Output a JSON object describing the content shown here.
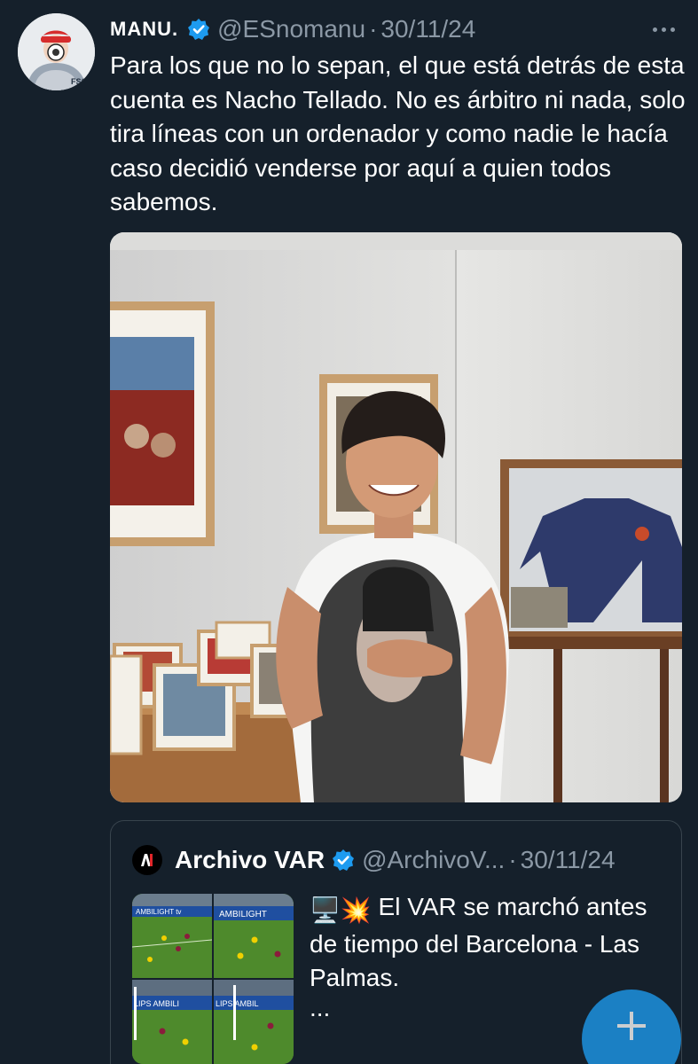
{
  "tweet": {
    "author_name": "MANU.",
    "handle": "@ESnomanu",
    "separator": "·",
    "date": "30/11/24",
    "text": "Para los que no lo sepan, el que está detrás de esta cuenta es Nacho Tellado. No es árbitro ni nada, solo tira líneas con un ordenador y como nadie le hacía caso decidió venderse por aquí a quien todos sabemos."
  },
  "quoted_tweet": {
    "author_name": "Archivo VAR",
    "handle": "@ArchivoV...",
    "separator": "·",
    "date": "30/11/24",
    "emoji": "🖥️💥",
    "text": "El VAR se marchó antes de tiempo del Barcelona - Las Palmas.",
    "ellipsis": "...",
    "thumbnail_banner": [
      "AMBILIGHT tv",
      "AMBILIGHT",
      "LIPS AMBILI",
      "LIPS AMBIL"
    ]
  },
  "icons": {
    "verified": "verified-badge-icon",
    "more": "more-options-icon",
    "compose": "plus-icon"
  },
  "colors": {
    "background": "#15202b",
    "text_primary": "#ffffff",
    "text_secondary": "#8b98a5",
    "accent": "#1d9bf0",
    "border": "#38444d"
  }
}
